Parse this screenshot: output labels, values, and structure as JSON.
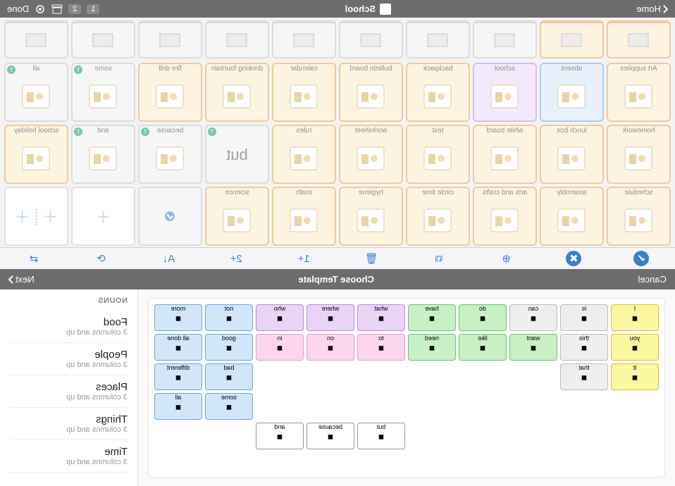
{
  "header": {
    "home": "Home",
    "title": "School",
    "done": "Done",
    "pages": [
      "1",
      "2"
    ]
  },
  "board": {
    "row0": [
      {
        "color": "orange"
      },
      {
        "color": "orange"
      },
      {
        "color": "grey"
      },
      {
        "color": "grey"
      },
      {
        "color": "grey"
      },
      {
        "color": "grey"
      },
      {
        "color": "grey"
      },
      {
        "color": "grey"
      },
      {
        "color": "grey"
      },
      {
        "color": "grey"
      }
    ],
    "rows": [
      [
        {
          "label": "Art supplies",
          "color": "orange",
          "folder": true
        },
        {
          "label": "absent",
          "color": "blue"
        },
        {
          "label": "school",
          "color": "purple"
        },
        {
          "label": "backpack",
          "color": "orange"
        },
        {
          "label": "bulletin board",
          "color": "orange"
        },
        {
          "label": "calendar",
          "color": "orange"
        },
        {
          "label": "drinking fountain",
          "color": "orange"
        },
        {
          "label": "fire drill",
          "color": "orange"
        },
        {
          "label": "some",
          "color": "grey",
          "badge": true
        },
        {
          "label": "all",
          "color": "grey",
          "badge": true
        }
      ],
      [
        {
          "label": "homework",
          "color": "orange"
        },
        {
          "label": "lunch box",
          "color": "orange"
        },
        {
          "label": "white board",
          "color": "orange"
        },
        {
          "label": "test",
          "color": "orange"
        },
        {
          "label": "worksheet",
          "color": "orange"
        },
        {
          "label": "rules",
          "color": "orange"
        },
        {
          "label": "but",
          "color": "grey",
          "big": true,
          "badge": true
        },
        {
          "label": "because",
          "color": "grey",
          "badge": true
        },
        {
          "label": "and",
          "color": "grey",
          "badge": true
        },
        {
          "label": "school holiday",
          "color": "orange"
        }
      ],
      [
        {
          "label": "schedule",
          "color": "orange"
        },
        {
          "label": "assembly",
          "color": "orange"
        },
        {
          "label": "arts and crafts",
          "color": "orange"
        },
        {
          "label": "circle time",
          "color": "orange"
        },
        {
          "label": "hygiene",
          "color": "orange"
        },
        {
          "label": "math",
          "color": "orange"
        },
        {
          "label": "science",
          "color": "orange"
        },
        {
          "label": "",
          "color": "grey",
          "mark": true
        },
        {
          "label": "",
          "color": "white",
          "add": true
        },
        {
          "label": "",
          "color": "white",
          "add": true,
          "split": true
        }
      ]
    ]
  },
  "toolbar": {
    "icons": [
      "check-filled",
      "check-outline",
      "add-page",
      "copy",
      "trash",
      "plus-1",
      "plus-2",
      "sort",
      "refresh",
      "swap"
    ]
  },
  "chooser": {
    "cancel": "Cancel",
    "title": "Choose Template",
    "next": "Next"
  },
  "sidebar": {
    "heading": "NOUNS",
    "cats": [
      {
        "name": "Food",
        "sub": "3 columns and up"
      },
      {
        "name": "People",
        "sub": "3 columns and up"
      },
      {
        "name": "Places",
        "sub": "3 columns and up"
      },
      {
        "name": "Things",
        "sub": "3 columns and up"
      },
      {
        "name": "Time",
        "sub": "3 columns and up"
      }
    ]
  },
  "template": {
    "rows": [
      [
        {
          "t": "I",
          "c": "yellow"
        },
        {
          "t": "is",
          "c": "grey"
        },
        {
          "t": "can",
          "c": "grey"
        },
        {
          "t": "do",
          "c": "green"
        },
        {
          "t": "have",
          "c": "green"
        },
        {
          "t": "what",
          "c": "purple"
        },
        {
          "t": "where",
          "c": "purple"
        },
        {
          "t": "who",
          "c": "purple"
        },
        {
          "t": "not",
          "c": "blue"
        },
        {
          "t": "more",
          "c": "blue"
        }
      ],
      [
        {
          "t": "you",
          "c": "yellow"
        },
        {
          "t": "this",
          "c": "grey"
        },
        {
          "t": "want",
          "c": "green"
        },
        {
          "t": "like",
          "c": "green"
        },
        {
          "t": "need",
          "c": "green"
        },
        {
          "t": "to",
          "c": "pink"
        },
        {
          "t": "on",
          "c": "pink"
        },
        {
          "t": "in",
          "c": "pink"
        },
        {
          "t": "good",
          "c": "blue"
        },
        {
          "t": "all done",
          "c": "blue"
        }
      ],
      [
        {
          "t": "it",
          "c": "yellow"
        },
        {
          "t": "that",
          "c": "grey"
        },
        null,
        null,
        null,
        null,
        null,
        null,
        {
          "t": "bad",
          "c": "blue"
        },
        {
          "t": "different",
          "c": "blue"
        }
      ],
      [
        null,
        null,
        null,
        null,
        null,
        null,
        null,
        null,
        {
          "t": "some",
          "c": "blue"
        },
        {
          "t": "all",
          "c": "blue"
        }
      ],
      [
        null,
        null,
        null,
        null,
        null,
        {
          "t": "but",
          "c": "white"
        },
        {
          "t": "because",
          "c": "white"
        },
        {
          "t": "and",
          "c": "white"
        }
      ]
    ]
  }
}
